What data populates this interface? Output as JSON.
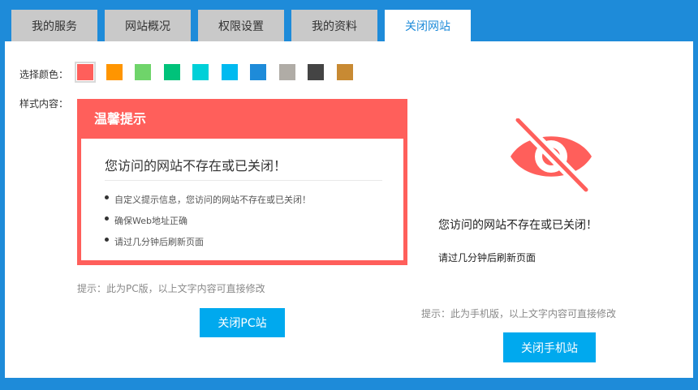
{
  "tabs": [
    {
      "label": "我的服务"
    },
    {
      "label": "网站概况"
    },
    {
      "label": "权限设置"
    },
    {
      "label": "我的资料"
    },
    {
      "label": "关闭网站"
    }
  ],
  "active_tab": "关闭网站",
  "color_picker": {
    "label": "选择颜色：",
    "swatches": [
      "#ff5f5b",
      "#ff9500",
      "#6fd46a",
      "#00c27a",
      "#00d0d8",
      "#00baf0",
      "#1e8bd9",
      "#b0aca6",
      "#444444",
      "#c88a33"
    ],
    "selected": "#ff5f5b"
  },
  "style_label": "样式内容：",
  "pc_card": {
    "title": "温馨提示",
    "heading": "您访问的网站不存在或已关闭！",
    "items": [
      "自定义提示信息，您访问的网站不存在或已关闭！",
      "确保Web地址正确",
      "请过几分钟后刷新页面"
    ]
  },
  "pc_hint": "提示：此为PC版，以上文字内容可直接修改",
  "pc_button": "关闭PC站",
  "mobile": {
    "icon": "eye-slash-icon",
    "heading": "您访问的网站不存在或已关闭！",
    "text": "请过几分钟后刷新页面",
    "hint": "提示：此为手机版，以上文字内容可直接修改",
    "button": "关闭手机站"
  },
  "colors": {
    "background": "#1e8bd9",
    "tab_inactive": "#c9c9c9",
    "active_text": "#1e8bd9",
    "accent": "#ff5f5b",
    "button": "#00a9ee"
  }
}
